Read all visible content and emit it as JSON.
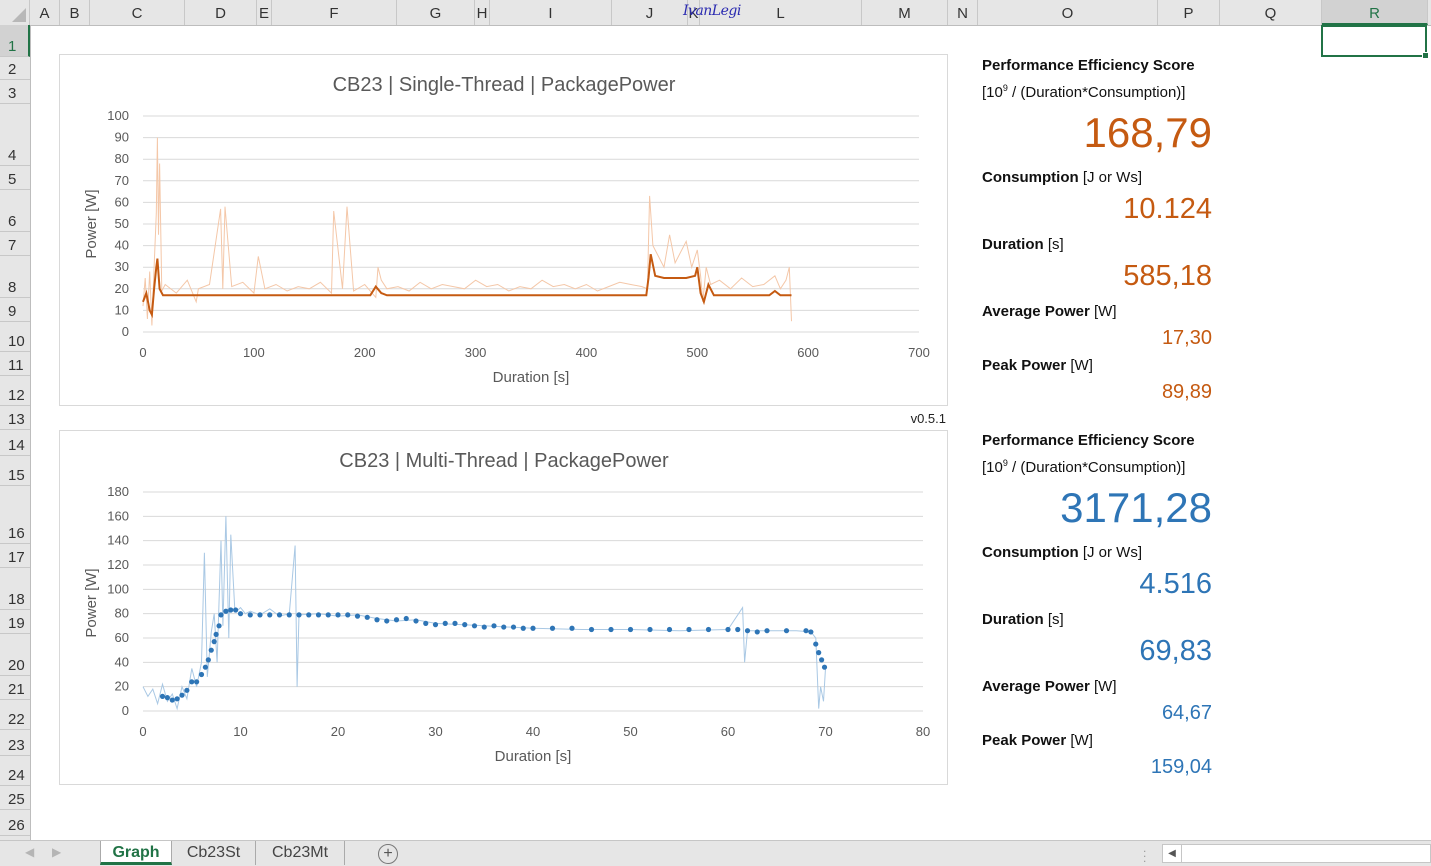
{
  "spreadsheet": {
    "columns": [
      "A",
      "B",
      "C",
      "D",
      "E",
      "F",
      "G",
      "H",
      "I",
      "J",
      "K",
      "L",
      "M",
      "N",
      "O",
      "P",
      "Q",
      "R"
    ],
    "rows": [
      "1",
      "2",
      "3",
      "4",
      "5",
      "6",
      "7",
      "8",
      "9",
      "10",
      "11",
      "12",
      "13",
      "14",
      "15",
      "16",
      "17",
      "18",
      "19",
      "20",
      "21",
      "22",
      "23",
      "24",
      "25",
      "26"
    ],
    "selected_cell": "R1",
    "logo_text": "IvanLegi",
    "version": "v0.5.1"
  },
  "colors": {
    "single_thread": "#c55a11",
    "single_thread_raw": "#f4c7a8",
    "multi_thread": "#2e75b6",
    "multi_thread_raw": "#a9c8e4",
    "accent": "#217346"
  },
  "single_panel": {
    "score_label": "Performance Efficiency Score",
    "score_formula_pre": "[10",
    "score_formula_sup": "9",
    "score_formula_post": " / (Duration*Consumption)]",
    "score_value": "168,79",
    "consumption_label": "Consumption",
    "consumption_unit": " [J or Ws]",
    "consumption_value": "10.124",
    "duration_label": "Duration",
    "duration_unit": " [s]",
    "duration_value": "585,18",
    "avg_label": "Average Power",
    "avg_unit": " [W]",
    "avg_value": "17,30",
    "peak_label": "Peak Power",
    "peak_unit": " [W]",
    "peak_value": "89,89"
  },
  "multi_panel": {
    "score_label": "Performance Efficiency Score",
    "score_formula_pre": "[10",
    "score_formula_sup": "9",
    "score_formula_post": " / (Duration*Consumption)]",
    "score_value": "3171,28",
    "consumption_label": "Consumption",
    "consumption_unit": " [J or Ws]",
    "consumption_value": "4.516",
    "duration_label": "Duration",
    "duration_unit": " [s]",
    "duration_value": "69,83",
    "avg_label": "Average Power",
    "avg_unit": " [W]",
    "avg_value": "64,67",
    "peak_label": "Peak Power",
    "peak_unit": " [W]",
    "peak_value": "159,04"
  },
  "sheet_tabs": [
    {
      "label": "Graph",
      "active": true
    },
    {
      "label": "Cb23St",
      "active": false
    },
    {
      "label": "Cb23Mt",
      "active": false
    }
  ],
  "chart_data": [
    {
      "type": "line",
      "title": "CB23 | Single-Thread | PackagePower",
      "xlabel": "Duration [s]",
      "ylabel": "Power [W]",
      "xlim": [
        0,
        700
      ],
      "ylim": [
        0,
        100
      ],
      "xticks": [
        0,
        100,
        200,
        300,
        400,
        500,
        600,
        700
      ],
      "yticks": [
        0,
        10,
        20,
        30,
        40,
        50,
        60,
        70,
        80,
        90,
        100
      ],
      "grid": true,
      "series": [
        {
          "style": "raw",
          "x": [
            0,
            2,
            4,
            6,
            8,
            10,
            12,
            13,
            14,
            15,
            17,
            20,
            30,
            40,
            48,
            50,
            60,
            70,
            72,
            74,
            80,
            90,
            100,
            104,
            110,
            120,
            130,
            140,
            150,
            160,
            170,
            172,
            180,
            184,
            190,
            200,
            210,
            212,
            215,
            220,
            230,
            240,
            250,
            260,
            270,
            280,
            290,
            300,
            310,
            320,
            330,
            340,
            350,
            360,
            370,
            380,
            390,
            400,
            410,
            420,
            430,
            440,
            450,
            455,
            457,
            460,
            470,
            475,
            480,
            490,
            495,
            500,
            503,
            505,
            508,
            512,
            520,
            530,
            540,
            550,
            560,
            570,
            575,
            580,
            583,
            585
          ],
          "y": [
            12,
            25,
            6,
            28,
            3,
            30,
            55,
            90,
            45,
            78,
            19,
            22,
            18,
            24,
            14,
            20,
            22,
            57,
            20,
            58,
            21,
            23,
            18,
            35,
            20,
            22,
            19,
            21,
            20,
            23,
            18,
            56,
            20,
            58,
            19,
            22,
            16,
            30,
            24,
            20,
            21,
            19,
            23,
            20,
            22,
            21,
            20,
            24,
            21,
            22,
            19,
            21,
            20,
            24,
            21,
            22,
            20,
            22,
            19,
            21,
            23,
            22,
            21,
            20,
            63,
            40,
            30,
            45,
            32,
            42,
            30,
            38,
            26,
            14,
            30,
            22,
            24,
            20,
            25,
            21,
            22,
            26,
            20,
            24,
            30,
            5
          ]
        },
        {
          "style": "smoothed",
          "x": [
            0,
            3,
            6,
            8,
            10,
            12,
            13,
            15,
            18,
            30,
            60,
            100,
            150,
            200,
            205,
            210,
            215,
            220,
            260,
            300,
            350,
            400,
            450,
            454,
            456,
            458,
            462,
            470,
            480,
            490,
            498,
            500,
            503,
            506,
            510,
            515,
            525,
            550,
            565,
            570,
            575,
            585
          ],
          "y": [
            14,
            18,
            10,
            8,
            20,
            30,
            34,
            20,
            17,
            17,
            17,
            17,
            17,
            17,
            17,
            21,
            18,
            17,
            17,
            17,
            17,
            17,
            17,
            17,
            25,
            36,
            26,
            25,
            25,
            25,
            26,
            30,
            18,
            14,
            22,
            17,
            17,
            17,
            17,
            19,
            17,
            17
          ]
        }
      ]
    },
    {
      "type": "scatter",
      "title": "CB23 | Multi-Thread | PackagePower",
      "xlabel": "Duration [s]",
      "ylabel": "Power [W]",
      "xlim": [
        0,
        80
      ],
      "ylim": [
        0,
        180
      ],
      "xticks": [
        0,
        10,
        20,
        30,
        40,
        50,
        60,
        70,
        80
      ],
      "yticks": [
        0,
        20,
        40,
        60,
        80,
        100,
        120,
        140,
        160,
        180
      ],
      "grid": true,
      "series": [
        {
          "style": "raw",
          "x": [
            0,
            0.5,
            1,
            1.5,
            2,
            2.5,
            3,
            3.5,
            4,
            4.5,
            5,
            5.5,
            6,
            6.3,
            6.6,
            7,
            7.3,
            7.6,
            8,
            8.2,
            8.5,
            8.8,
            9,
            9.4,
            9.6,
            10,
            10.5,
            11,
            12,
            13,
            14,
            15,
            15.6,
            15.8,
            16,
            18,
            20,
            22,
            24,
            26,
            28,
            30,
            35,
            40,
            45,
            50,
            55,
            60,
            61.5,
            61.7,
            62,
            65,
            67,
            68.5,
            69,
            69.3,
            69.5,
            69.8,
            70
          ],
          "y": [
            20,
            12,
            18,
            6,
            22,
            8,
            14,
            2,
            20,
            10,
            35,
            20,
            40,
            130,
            28,
            65,
            80,
            40,
            140,
            70,
            160,
            60,
            145,
            85,
            82,
            85,
            80,
            82,
            79,
            84,
            78,
            80,
            136,
            20,
            79,
            80,
            78,
            79,
            76,
            74,
            75,
            72,
            70,
            68,
            67,
            67,
            66,
            67,
            85,
            40,
            66,
            66,
            66,
            65,
            60,
            2,
            20,
            8,
            35
          ]
        },
        {
          "style": "smoothed",
          "x": [
            2,
            2.5,
            3,
            3.5,
            4,
            4.5,
            5,
            5.5,
            6,
            6.4,
            6.7,
            7,
            7.3,
            7.5,
            7.8,
            8,
            8.5,
            9,
            9.5,
            10,
            11,
            12,
            13,
            14,
            15,
            16,
            17,
            18,
            19,
            20,
            21,
            22,
            23,
            24,
            25,
            26,
            27,
            28,
            29,
            30,
            31,
            32,
            33,
            34,
            35,
            36,
            37,
            38,
            39,
            40,
            42,
            44,
            46,
            48,
            50,
            52,
            54,
            56,
            58,
            60,
            61,
            62,
            63,
            64,
            66,
            68,
            68.5,
            69,
            69.3,
            69.6,
            69.9
          ],
          "y": [
            12,
            11,
            9,
            10,
            13,
            17,
            24,
            24,
            30,
            36,
            42,
            50,
            57,
            63,
            70,
            79,
            82,
            83,
            83,
            80,
            79,
            79,
            79,
            79,
            79,
            79,
            79,
            79,
            79,
            79,
            79,
            78,
            77,
            75,
            74,
            75,
            76,
            74,
            72,
            71,
            72,
            72,
            71,
            70,
            69,
            70,
            69,
            69,
            68,
            68,
            68,
            68,
            67,
            67,
            67,
            67,
            67,
            67,
            67,
            67,
            67,
            66,
            65,
            66,
            66,
            66,
            65,
            55,
            48,
            42,
            36
          ]
        }
      ]
    }
  ]
}
